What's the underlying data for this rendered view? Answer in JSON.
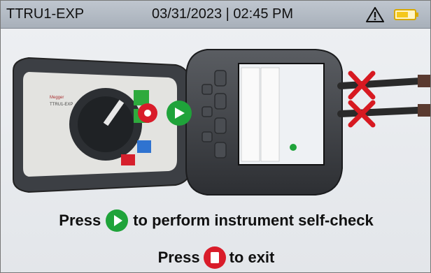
{
  "status_bar": {
    "device_name": "TTRU1-EXP",
    "datetime": "03/31/2023 | 02:45 PM",
    "warning_icon": "warning-triangle-icon",
    "battery_icon": "battery-icon",
    "battery_color": "#f5c81a"
  },
  "illustration": {
    "cables_status": "disconnected",
    "start_button_color": "#1fa33a",
    "stop_button_color": "#d91c2a"
  },
  "instructions": {
    "line1_prefix": "Press",
    "line1_suffix": "to perform instrument self-check",
    "line2_prefix": "Press",
    "line2_suffix": "to exit"
  }
}
